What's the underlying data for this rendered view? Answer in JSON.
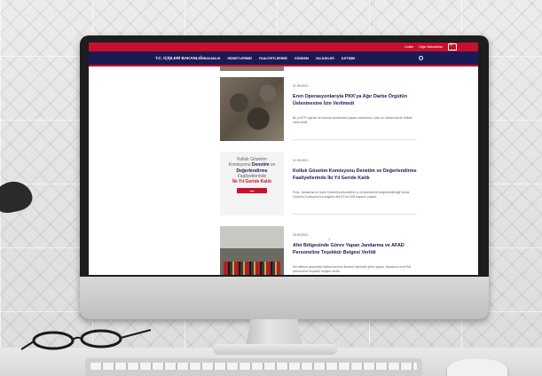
{
  "site": {
    "brand": "T.C. İÇİŞLERİ BAKANLIĞI",
    "topbar_links": [
      "Linkler",
      "Diğer Bakanlıklar"
    ],
    "nav": [
      "BAKANLIK",
      "HİZMETLERİMİZ",
      "FAALİYETLERİMİZ",
      "GÜNDEM",
      "VALİLİKLER",
      "İLETİŞİM"
    ]
  },
  "news": [
    {
      "date": "21.09.2021",
      "title": "Eren Operasyonlarıyla PKK'ya Ağır Darbe Örgütün Üslenmesine İzin Verilmedi",
      "excerpt": "Bu yıl 979 sığınak ve barınak içerisindeki yaşam malzemesi, silah ve mühimmat ile birlikte imha edildi."
    },
    {
      "date": "21.09.2021",
      "title": "Kolluk Gözetim Komisyonu Denetim ve Değerlendirme Faaliyetlerinde İki Yıl Geride Kaldı",
      "excerpt": "Polis, Jandarma ve Sahil Güvenlik personelinin iş ve işlemlerinin değerlendirildiği Kolluk Gözetim Komisyonu'na bugüne dek 92 bin 208 başvuru yapıldı.",
      "promo": {
        "line1": "Kolluk Gözetim",
        "line2": "Komisyonu",
        "line2b": "Denetim",
        "line2c": "ve",
        "line3": "Değerlendirme",
        "line4": "Faaliyetlerinde",
        "line5": "İki Yıl Geride Kaldı"
      }
    },
    {
      "date": "20.09.2021",
      "title": "Afet Bölgesinde Görev Yapan Jandarma ve AFAD Personeline Teşekkür Belgesi Verildi",
      "excerpt": "Sel afetinin yaşandığı Kastamonu'nun Bozkurt ilçesinde görev yapan Jandarma ve AFAD personeline teşekkür belgesi verildi."
    }
  ],
  "colors": {
    "primary": "#1b1a54",
    "accent": "#c8102e"
  }
}
